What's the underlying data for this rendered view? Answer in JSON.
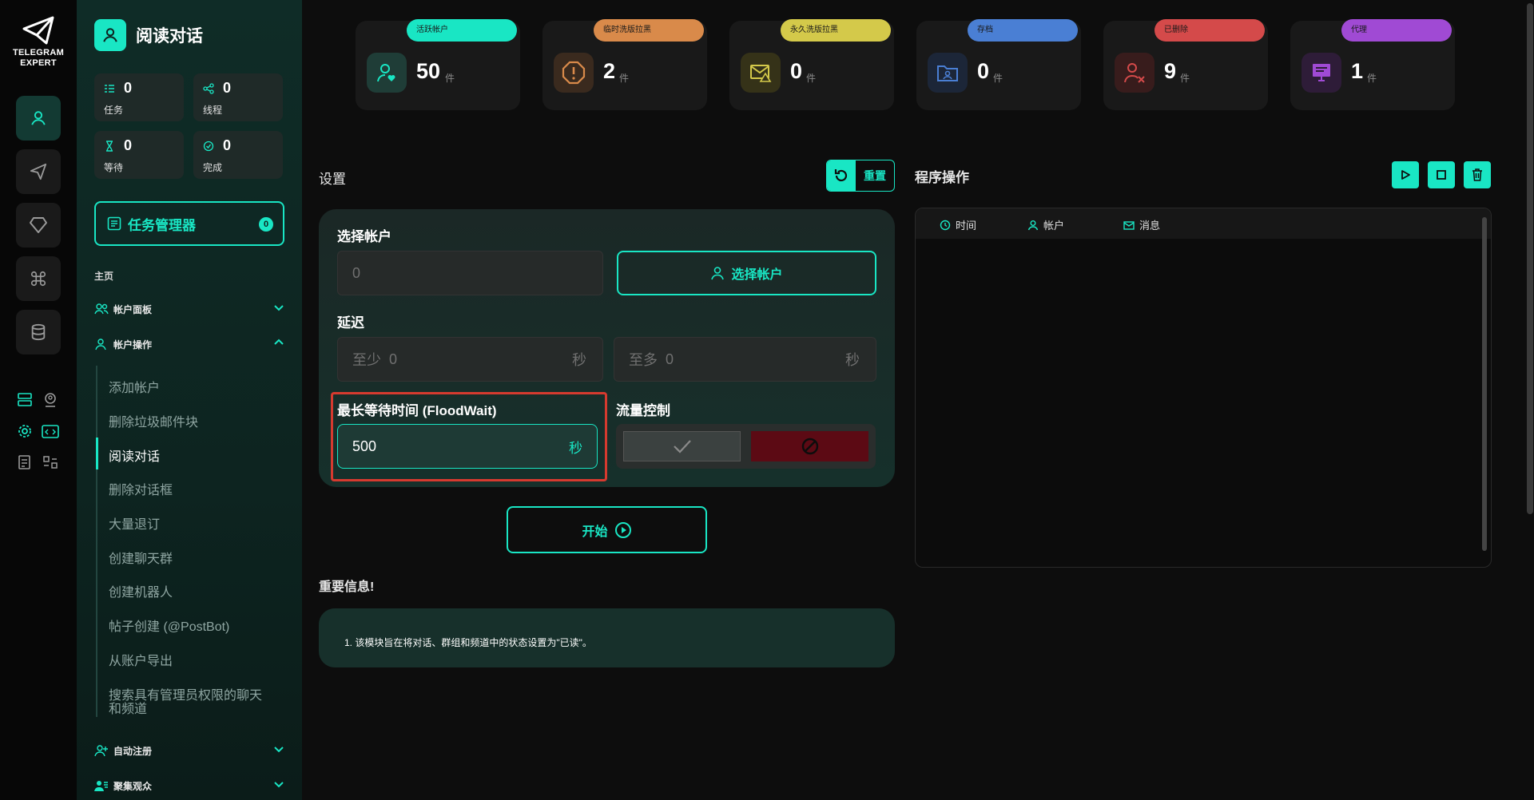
{
  "logo": {
    "line1": "TELEGRAM",
    "line2": "EXPERT"
  },
  "rail": {
    "icons": [
      "user-icon",
      "send-icon",
      "diamond-icon",
      "command-icon",
      "database-icon"
    ]
  },
  "sidebar": {
    "title": "阅读对话",
    "stats": [
      {
        "value": "0",
        "label": "任务",
        "icon": "list-icon"
      },
      {
        "value": "0",
        "label": "线程",
        "icon": "share-icon"
      },
      {
        "value": "0",
        "label": "等待",
        "icon": "hourglass-icon"
      },
      {
        "value": "0",
        "label": "完成",
        "icon": "check-circle-icon"
      }
    ],
    "task_manager": {
      "label": "任务管理器",
      "badge": "0"
    },
    "home_label": "主页",
    "groups": {
      "account_panel": "帐户面板",
      "account_ops": "帐户操作",
      "auto_register": "自动注册",
      "gather_viewers": "聚集观众"
    },
    "sub_items": [
      "添加帐户",
      "删除垃圾邮件块",
      "阅读对话",
      "删除对话框",
      "大量退订",
      "创建聊天群",
      "创建机器人",
      "帖子创建 (@PostBot)",
      "从账户导出",
      "搜索具有管理员权限的聊天",
      "和频道"
    ]
  },
  "cards": [
    {
      "pill": "活跃帐户",
      "value": "50",
      "unit": "件",
      "color": "#19e6c4"
    },
    {
      "pill": "临时洗版拉黑",
      "value": "2",
      "unit": "件",
      "color": "#d98a4a"
    },
    {
      "pill": "永久洗版拉黑",
      "value": "0",
      "unit": "件",
      "color": "#d4c94a"
    },
    {
      "pill": "存档",
      "value": "0",
      "unit": "件",
      "color": "#4a7fd4"
    },
    {
      "pill": "已删除",
      "value": "9",
      "unit": "件",
      "color": "#d44a4a"
    },
    {
      "pill": "代理",
      "value": "1",
      "unit": "件",
      "color": "#a04ad4"
    }
  ],
  "settings": {
    "title": "设置",
    "reset": "重置",
    "select_account_label": "选择帐户",
    "select_account_value": "0",
    "select_account_button": "选择帐户",
    "delay_label": "延迟",
    "delay_min": {
      "prefix": "至少",
      "value": "0",
      "unit": "秒"
    },
    "delay_max": {
      "prefix": "至多",
      "value": "0",
      "unit": "秒"
    },
    "flood_label": "最长等待时间 (FloodWait)",
    "flood_value": "500",
    "flood_unit": "秒",
    "flow_label": "流量控制",
    "start": "开始"
  },
  "info": {
    "title": "重要信息!",
    "text": "1. 该模块旨在将对话、群组和频道中的状态设置为\"已读\"。"
  },
  "ops": {
    "title": "程序操作",
    "columns": [
      "时间",
      "帐户",
      "消息"
    ]
  }
}
